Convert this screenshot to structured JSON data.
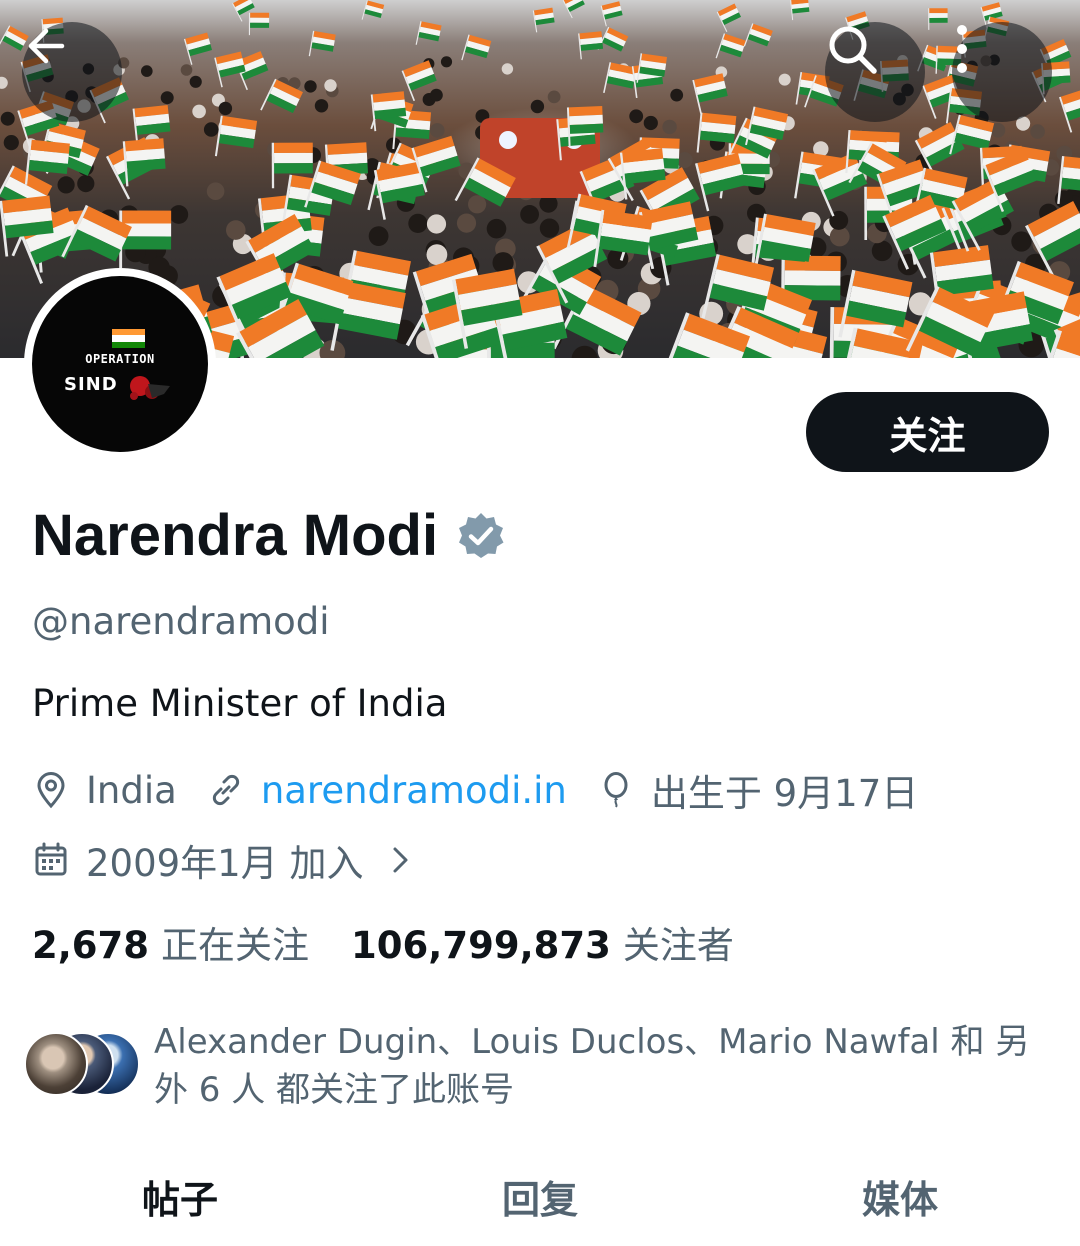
{
  "header": {
    "back_icon": "arrow-left-icon",
    "search_icon": "search-icon",
    "more_icon": "more-vertical-icon"
  },
  "banner": {
    "description_icon": "crowd-photo"
  },
  "avatar": {
    "line1": "OPERATION",
    "line2": "SIND"
  },
  "follow_button": {
    "label": "关注"
  },
  "profile": {
    "name": "Narendra Modi",
    "verified_icon": "verified-badge-icon",
    "handle": "@narendramodi",
    "bio": "Prime Minister of India",
    "location": "India",
    "website": "narendramodi.in",
    "birthday": "出生于 9月17日",
    "joined": "2009年1月 加入"
  },
  "stats": {
    "following_count": "2,678",
    "following_label": "正在关注",
    "followers_count": "106,799,873",
    "followers_label": "关注者"
  },
  "followed_by": {
    "text": "Alexander Dugin、Louis Duclos、Mario Nawfal 和 另外 6 人 都关注了此账号"
  },
  "tabs": [
    {
      "label": "帖子",
      "active": true
    },
    {
      "label": "回复",
      "active": false
    },
    {
      "label": "媒体",
      "active": false
    }
  ],
  "colors": {
    "primary_text": "#0f1419",
    "secondary_text": "#536471",
    "link": "#1d9bf0",
    "follow_button_bg": "#0f1419"
  }
}
